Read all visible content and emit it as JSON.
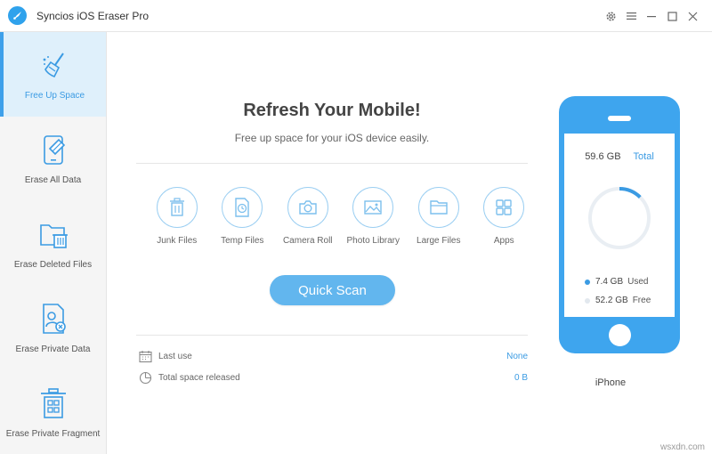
{
  "app": {
    "title": "Syncios iOS Eraser Pro"
  },
  "sidebar": {
    "items": [
      {
        "label": "Free Up Space",
        "icon": "broom-icon",
        "active": true
      },
      {
        "label": "Erase All Data",
        "icon": "phone-eraser-icon"
      },
      {
        "label": "Erase Deleted Files",
        "icon": "folder-trash-icon"
      },
      {
        "label": "Erase Private Data",
        "icon": "private-doc-icon"
      },
      {
        "label": "Erase Private Fragment",
        "icon": "fragment-trash-icon"
      }
    ]
  },
  "main": {
    "title": "Refresh Your Mobile!",
    "subtitle": "Free up space for your iOS device easily.",
    "categories": [
      {
        "label": "Junk Files",
        "icon": "trash-icon"
      },
      {
        "label": "Temp Files",
        "icon": "temp-file-icon"
      },
      {
        "label": "Camera Roll",
        "icon": "camera-icon"
      },
      {
        "label": "Photo Library",
        "icon": "photo-icon"
      },
      {
        "label": "Large Files",
        "icon": "folder-icon"
      },
      {
        "label": "Apps",
        "icon": "apps-icon"
      }
    ],
    "scan_button": "Quick Scan",
    "last_use": {
      "label": "Last use",
      "value": "None"
    },
    "space_released": {
      "label": "Total space released",
      "value": "0 B"
    }
  },
  "device": {
    "capacity": "59.6 GB",
    "capacity_label": "Total",
    "used": "7.4 GB",
    "used_label": "Used",
    "free": "52.2 GB",
    "free_label": "Free",
    "used_fraction": 0.124,
    "name": "iPhone"
  },
  "watermark": "wsxdn.com",
  "colors": {
    "accent": "#3ea5ee",
    "button": "#62b6ee",
    "used": "#3b9be3",
    "free": "#e9eef3"
  }
}
